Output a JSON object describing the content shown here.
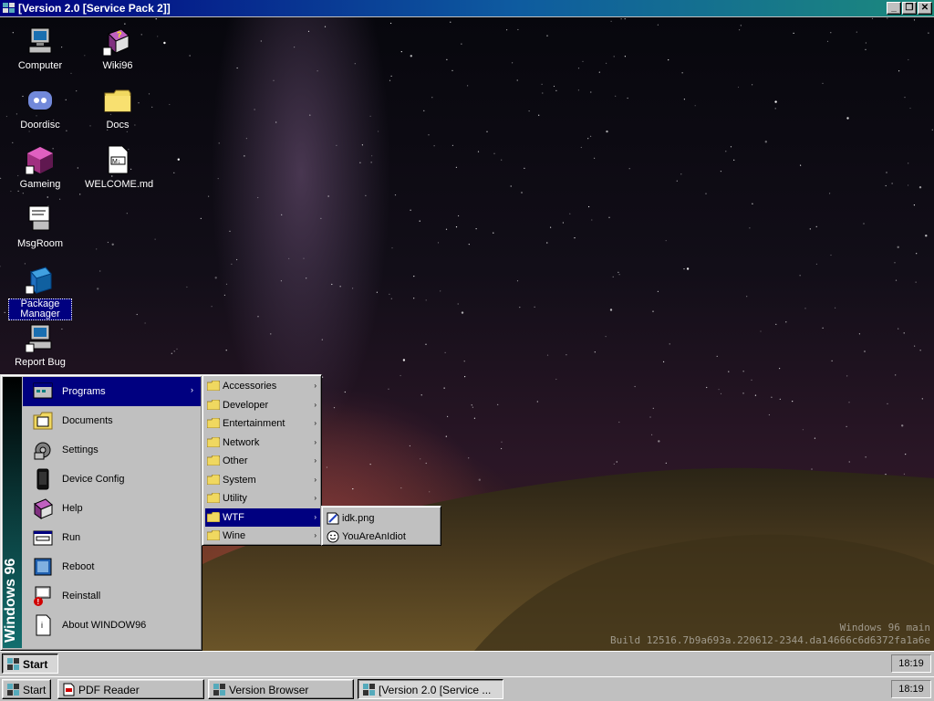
{
  "window": {
    "title": "[Version 2.0 [Service Pack 2]]",
    "buttons": {
      "minimize": "_",
      "maximize": "❐",
      "close": "✕"
    }
  },
  "desktop": {
    "icons": [
      {
        "label": "Computer",
        "icon": "computer-icon"
      },
      {
        "label": "Wiki96",
        "icon": "help-book-icon"
      },
      {
        "label": "Doordisc",
        "icon": "discord-icon"
      },
      {
        "label": "Docs",
        "icon": "folder-icon"
      },
      {
        "label": "Gameing",
        "icon": "game-cube-icon"
      },
      {
        "label": "WELCOME.md",
        "icon": "markdown-file-icon"
      },
      {
        "label": "MsgRoom",
        "icon": "chat-icon"
      },
      {
        "label": "Package Manager",
        "icon": "package-icon"
      },
      {
        "label": "Report Bug",
        "icon": "bug-report-icon"
      }
    ],
    "watermark": {
      "line1": "Windows 96 main",
      "line2": "Build 12516.7b9a693a.220612-2344.da14666c6d6372fa1a6e"
    }
  },
  "start_menu": {
    "sidebar_text": "Windows 96",
    "items": [
      {
        "label": "Programs",
        "has_submenu": true
      },
      {
        "label": "Documents"
      },
      {
        "label": "Settings"
      },
      {
        "label": "Device Config"
      },
      {
        "label": "Help"
      },
      {
        "label": "Run"
      },
      {
        "label": "Reboot"
      },
      {
        "label": "Reinstall"
      },
      {
        "label": "About WINDOW96"
      }
    ],
    "programs": [
      "Accessories",
      "Developer",
      "Entertainment",
      "Network",
      "Other",
      "System",
      "Utility",
      "WTF",
      "Wine"
    ],
    "wtf_items": [
      {
        "label": "idk.png",
        "icon": "image-file-icon"
      },
      {
        "label": "YouAreAnIdiot",
        "icon": "smiley-icon"
      }
    ],
    "arrow": "›"
  },
  "taskbar_inner": {
    "start_label": "Start",
    "clock": "18:19"
  },
  "taskbar_outer": {
    "start_label": "Start",
    "buttons": [
      "PDF Reader",
      "Version Browser",
      "[Version 2.0 [Service ..."
    ],
    "clock": "18:19"
  }
}
